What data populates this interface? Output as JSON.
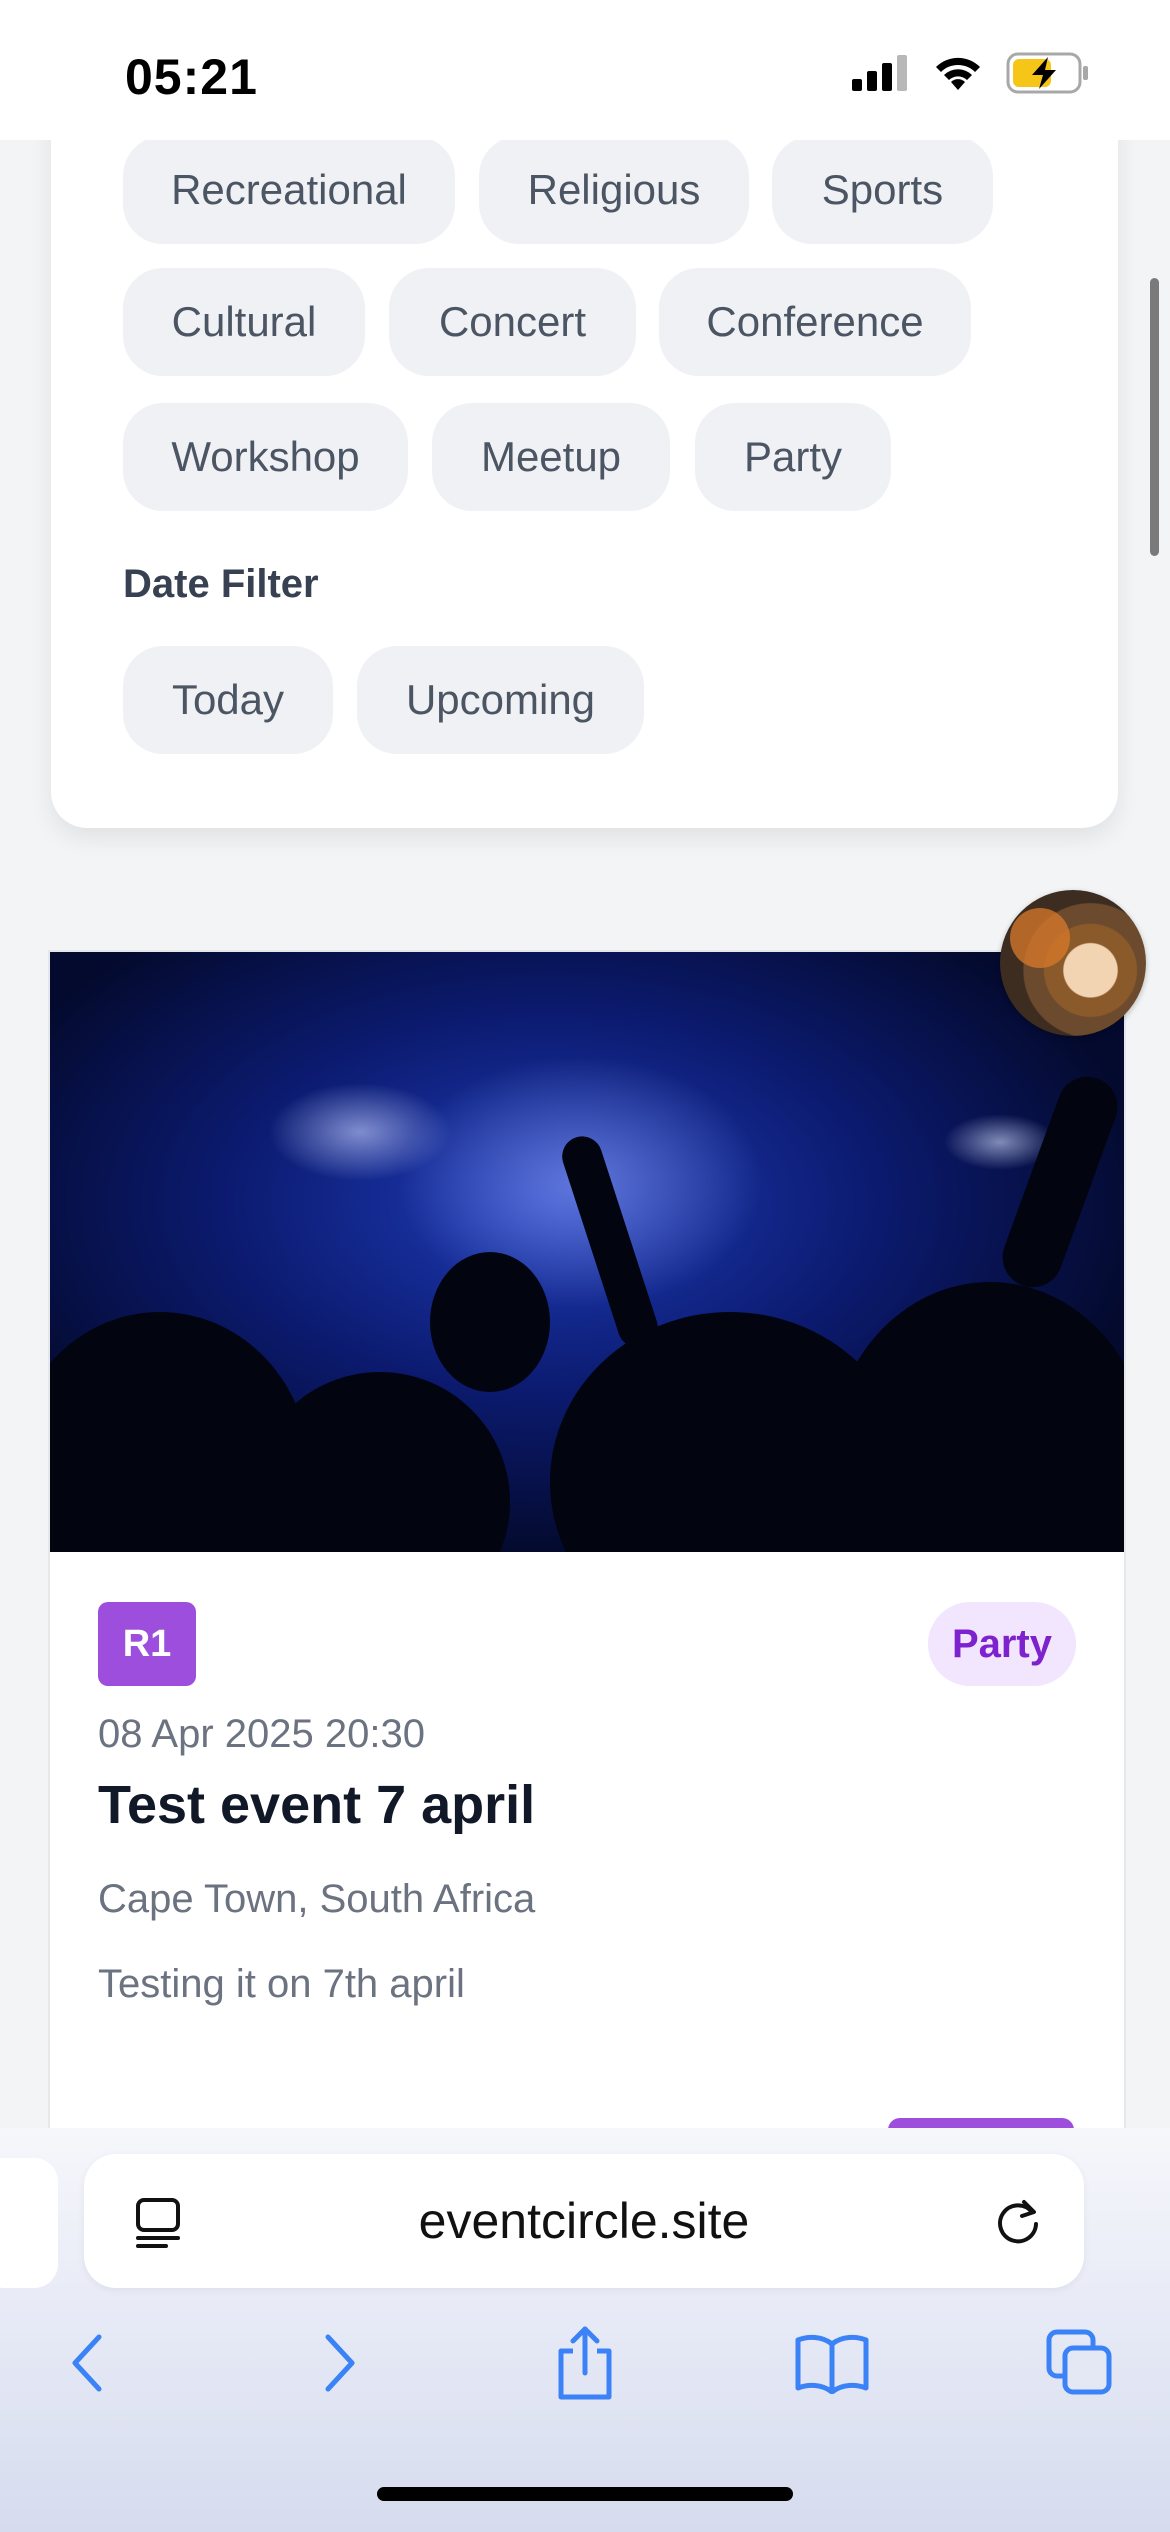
{
  "status_bar": {
    "time": "05:21"
  },
  "filters": {
    "category_chips": [
      "Recreational",
      "Religious",
      "Sports",
      "Cultural",
      "Concert",
      "Conference",
      "Workshop",
      "Meetup",
      "Party"
    ],
    "date_filter_label": "Date Filter",
    "date_chips": [
      "Today",
      "Upcoming"
    ]
  },
  "event": {
    "badge": "R1",
    "category": "Party",
    "date": "08 Apr 2025 20:30",
    "title": "Test event 7 april",
    "location": "Cape Town, South Africa",
    "description": "Testing it on 7th april"
  },
  "browser": {
    "url": "eventcircle.site",
    "icons": [
      "reader-icon",
      "reload-icon",
      "back-icon",
      "forward-icon",
      "share-icon",
      "bookmarks-icon",
      "tabs-icon"
    ]
  },
  "colors": {
    "accent": "#9d4edd",
    "accent_light": "#f1e6fd",
    "safari_blue": "#3b82f6"
  }
}
